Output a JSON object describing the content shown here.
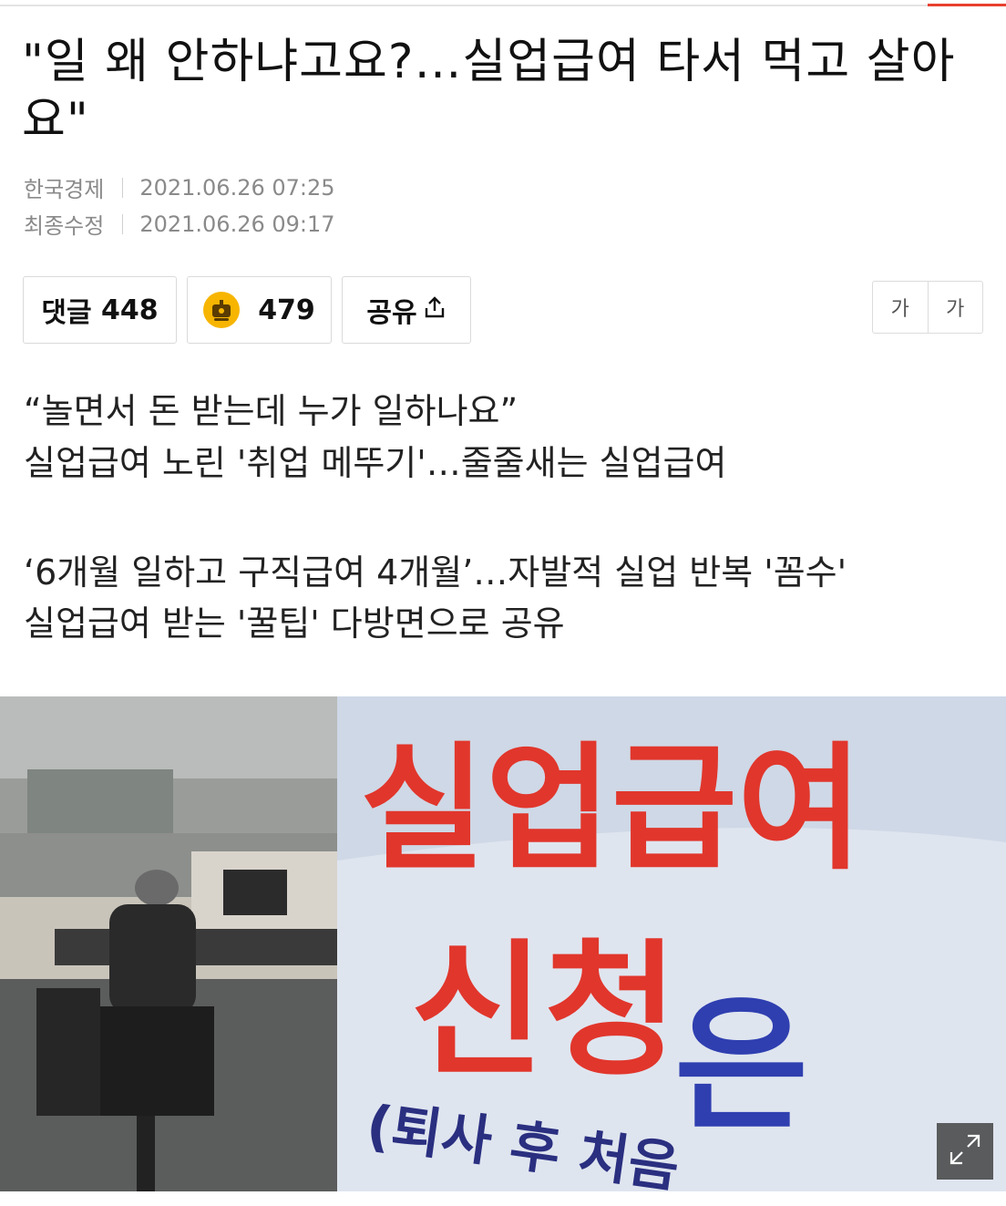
{
  "article": {
    "headline": "\"일 왜 안하냐고요?…실업급여 타서 먹고 살아요\"",
    "source": "한국경제",
    "published": "2021.06.26 07:25",
    "modified_label": "최종수정",
    "modified": "2021.06.26 09:17"
  },
  "actions": {
    "comment_label": "댓글",
    "comment_count": "448",
    "reaction_count": "479",
    "share_label": "공유",
    "font_small": "가",
    "font_large": "가"
  },
  "summary": [
    "“놀면서 돈 받는데 누가 일하나요”",
    "실업급여 노린 '취업 메뚜기'…줄줄새는 실업급여",
    "‘6개월 일하고 구직급여 4개월’…자발적 실업 반복 '꼼수'",
    "실업급여 받는 '꿀팁' 다방면으로 공유"
  ],
  "photo": {
    "sign_line1": "실업급여",
    "sign_line2": "신청",
    "sign_line3": "은",
    "sign_line4": "(퇴사 후 처음"
  },
  "colors": {
    "accent": "#e8402f",
    "emoji": "#f7b500",
    "sign_red": "#e1362c",
    "sign_blue": "#2f3fb0"
  },
  "icons": [
    "reaction-emoji-icon",
    "share-icon",
    "expand-icon"
  ]
}
